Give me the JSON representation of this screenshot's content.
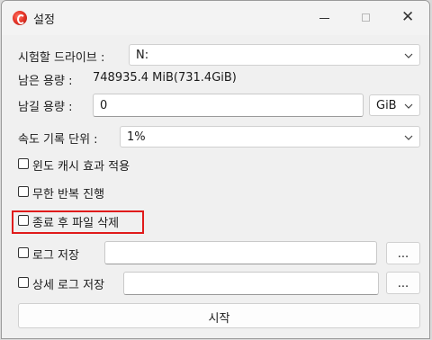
{
  "window": {
    "title": "설정",
    "close_glyph": "✕"
  },
  "drive": {
    "label": "시험할 드라이브 :",
    "value": "N:"
  },
  "free_space": {
    "label": "남은 용량 :",
    "value": "748935.4 MiB(731.4GiB)"
  },
  "leave_space": {
    "label": "남길 용량 :",
    "value": "0",
    "unit": "GiB"
  },
  "speed_unit": {
    "label": "속도 기록 단위 :",
    "value": "1%"
  },
  "options": {
    "windows_cache": {
      "label": "윈도 캐시 효과 적용",
      "checked": false
    },
    "infinite_loop": {
      "label": "무한 반복 진행",
      "checked": false
    },
    "delete_after": {
      "label": "종료 후 파일 삭제",
      "checked": false
    }
  },
  "log_save": {
    "label": "로그 저장",
    "value": "",
    "browse_label": "..."
  },
  "detailed_log": {
    "label": "상세 로그 저장",
    "value": "",
    "browse_label": "..."
  },
  "start_button": {
    "label": "시작"
  },
  "colors": {
    "highlight": "#e01b1b",
    "window_bg": "#f0f0f0"
  }
}
